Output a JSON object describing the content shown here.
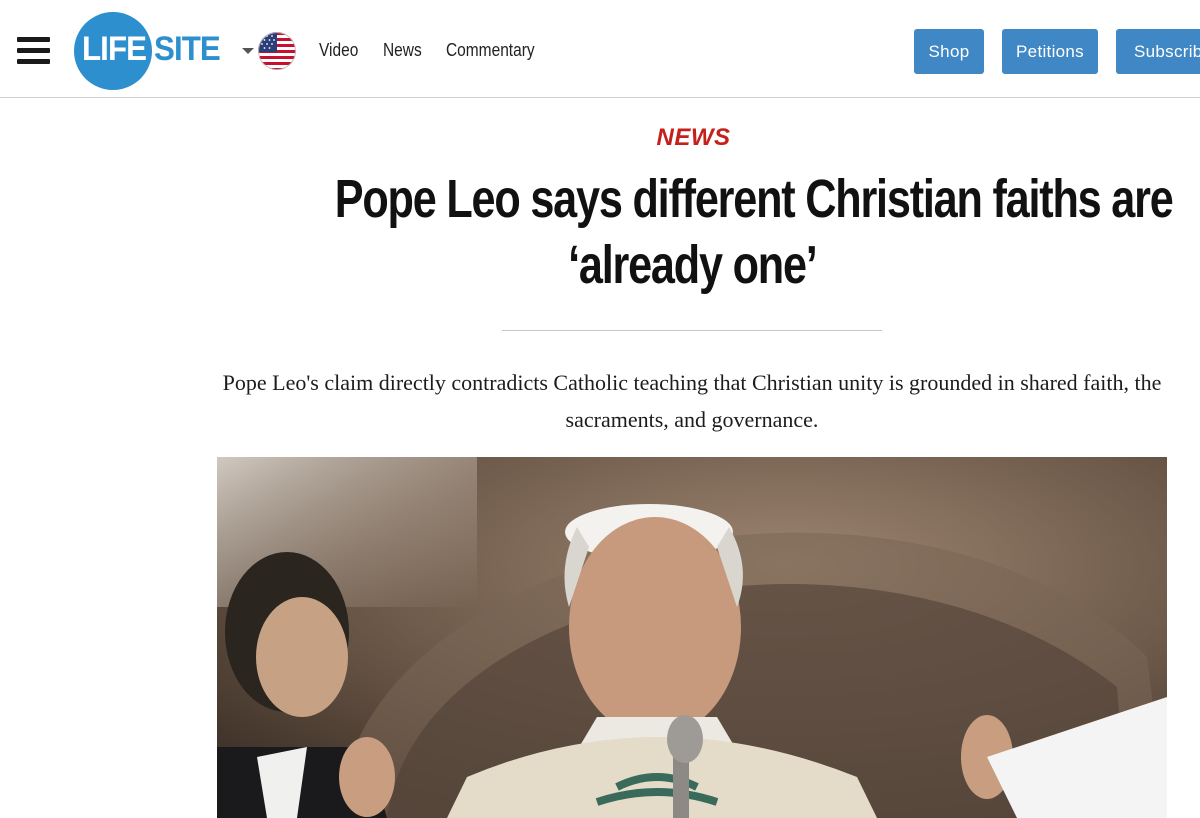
{
  "header": {
    "logo": {
      "part1": "LIFE",
      "part2": "SITE"
    },
    "nav": [
      "Video",
      "News",
      "Commentary"
    ],
    "buttons": {
      "shop": "Shop",
      "petitions": "Petitions",
      "subscribe": "Subscribe"
    },
    "colors": {
      "brand_blue": "#2d8fce",
      "button_blue": "#3f87c5"
    },
    "icons": {
      "menu": "hamburger-menu-icon",
      "region": "us-flag-icon",
      "dropdown": "caret-down-icon"
    }
  },
  "article": {
    "kicker": "NEWS",
    "headline": [
      "Pope Leo says different Christian faiths are",
      "‘already one’"
    ],
    "dek": "Pope Leo's claim directly contradicts Catholic teaching that Christian unity is grounded in shared faith, the sacraments, and governance.",
    "colors": {
      "kicker": "#c4211d"
    }
  }
}
